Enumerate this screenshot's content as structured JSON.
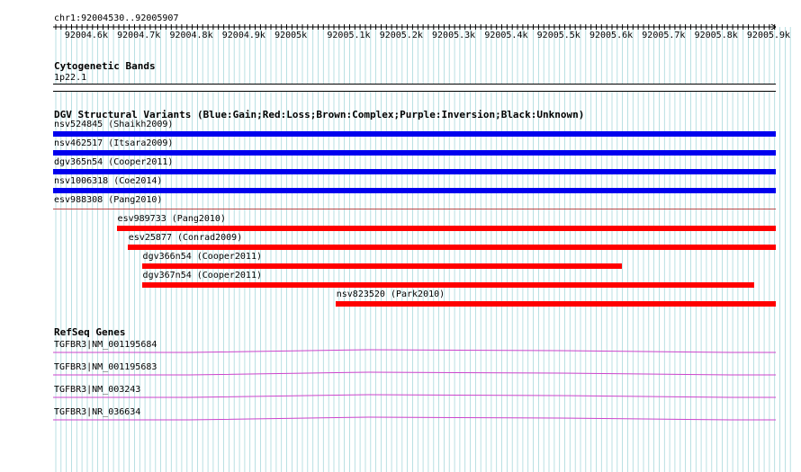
{
  "colors": {
    "grid": "#a8d8dc",
    "gain": "#0000ee",
    "loss": "#ff0000",
    "track_line": "#b84a4a",
    "gene": "#cc44cc"
  },
  "ruler": {
    "location": "chr1:92004530..92005907",
    "ticks": [
      "92004.6k",
      "92004.7k",
      "92004.8k",
      "92004.9k",
      "92005k",
      "92005.1k",
      "92005.2k",
      "92005.3k",
      "92005.4k",
      "92005.5k",
      "92005.6k",
      "92005.7k",
      "92005.8k",
      "92005.9k"
    ]
  },
  "cytoband": {
    "title": "Cytogenetic Bands",
    "band": "1p22.1"
  },
  "dgv": {
    "title": "DGV Structural Variants (Blue:Gain;Red:Loss;Brown:Complex;Purple:Inversion;Black:Unknown)",
    "variants": [
      {
        "label": "nsv524845 (Shaikh2009)",
        "type": "gain",
        "start": 92004530,
        "end": 92005907
      },
      {
        "label": "nsv462517 (Itsara2009)",
        "type": "gain",
        "start": 92004530,
        "end": 92005907
      },
      {
        "label": "dgv365n54 (Cooper2011)",
        "type": "gain",
        "start": 92004530,
        "end": 92005907
      },
      {
        "label": "nsv1006318 (Coe2014)",
        "type": "gain",
        "start": 92004530,
        "end": 92005907
      },
      {
        "label": "esv988308 (Pang2010)",
        "type": "loss-thin",
        "start": 92004530,
        "end": 92005907
      },
      {
        "label": "esv989733 (Pang2010)",
        "type": "loss",
        "start": 92004651,
        "end": 92005907
      },
      {
        "label": "esv25877 (Conrad2009)",
        "type": "loss",
        "start": 92004672,
        "end": 92005907
      },
      {
        "label": "dgv366n54 (Cooper2011)",
        "type": "loss",
        "start": 92004699,
        "end": 92005613
      },
      {
        "label": "dgv367n54 (Cooper2011)",
        "type": "loss",
        "start": 92004699,
        "end": 92005865
      },
      {
        "label": "nsv823520 (Park2010)",
        "type": "loss",
        "start": 92005068,
        "end": 92005907
      }
    ]
  },
  "refseq": {
    "title": "RefSeq Genes",
    "genes": [
      {
        "label": "TGFBR3|NM_001195684"
      },
      {
        "label": "TGFBR3|NM_001195683"
      },
      {
        "label": "TGFBR3|NM_003243"
      },
      {
        "label": "TGFBR3|NR_036634"
      }
    ]
  }
}
